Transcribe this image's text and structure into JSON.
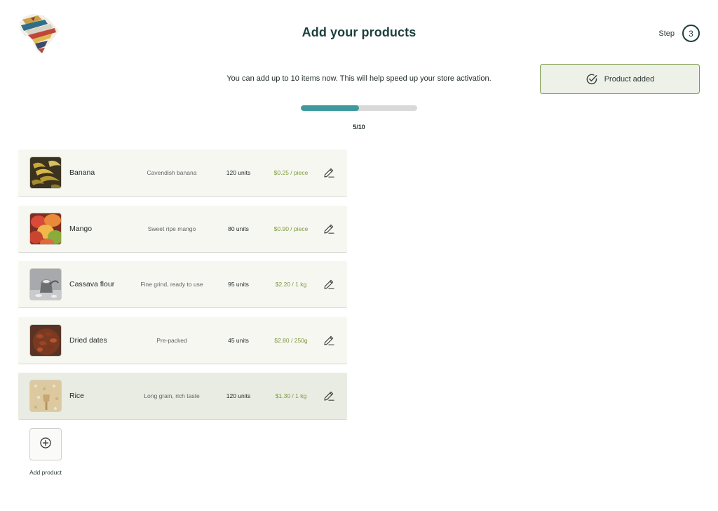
{
  "header": {
    "title": "Add your products",
    "step_label": "Step",
    "step_number": "3"
  },
  "intro_text": "You can add up to 10 items now. This will help speed up your store activation.",
  "toast": {
    "message": "Product added",
    "icon": "check-circle-icon"
  },
  "progress": {
    "current": 5,
    "max": 10,
    "fraction": 0.5,
    "label": "5/10"
  },
  "products": [
    {
      "name": "Banana",
      "description": "Cavendish banana",
      "quantity": "120 units",
      "price": "$0.25 / piece",
      "image": "banana-image"
    },
    {
      "name": "Mango",
      "description": "Sweet ripe mango",
      "quantity": "80 units",
      "price": "$0.90 / piece",
      "image": "mango-image"
    },
    {
      "name": "Cassava flour",
      "description": "Fine grind, ready to use",
      "quantity": "95 units",
      "price": "$2.20 / 1 kg",
      "image": "cassava-flour-image"
    },
    {
      "name": "Dried dates",
      "description": "Pre-packed",
      "quantity": "45 units",
      "price": "$2.80 / 250g",
      "image": "dried-dates-image"
    },
    {
      "name": "Rice",
      "description": "Long grain, rich taste",
      "quantity": "120 units",
      "price": "$1.30 / 1 kg",
      "image": "rice-image"
    }
  ],
  "add_product_label": "Add product",
  "colors": {
    "accent": "#3f9a9e",
    "title": "#1d3f3c",
    "price": "#7a9a3c",
    "toast_bg": "#eef1e8",
    "toast_border": "#7a9a4a"
  }
}
